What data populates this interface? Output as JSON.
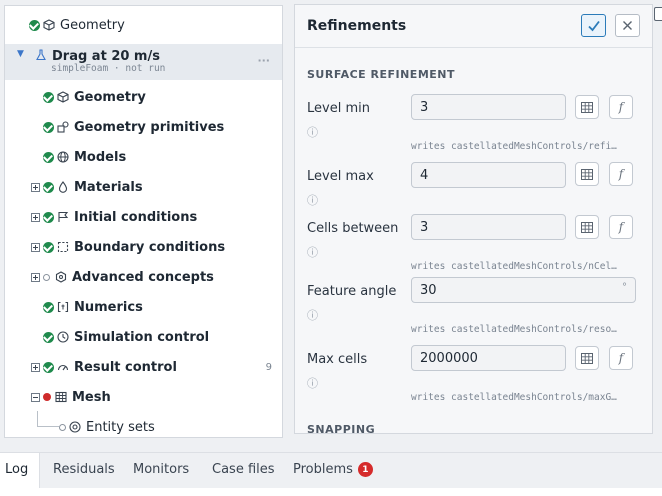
{
  "tree": {
    "items": [
      {
        "label": "Geometry"
      },
      {
        "label": "Drag at 20 m/s",
        "sub": "simpleFoam · not run",
        "more": "···"
      },
      {
        "label": "Geometry"
      },
      {
        "label": "Geometry primitives"
      },
      {
        "label": "Models"
      },
      {
        "label": "Materials"
      },
      {
        "label": "Initial conditions"
      },
      {
        "label": "Boundary conditions"
      },
      {
        "label": "Advanced concepts"
      },
      {
        "label": "Numerics"
      },
      {
        "label": "Simulation control"
      },
      {
        "label": "Result control",
        "count": "9"
      },
      {
        "label": "Mesh"
      },
      {
        "label": "Entity sets"
      }
    ]
  },
  "panel": {
    "title": "Refinements",
    "section_surface": "SURFACE REFINEMENT",
    "section_snapping": "SNAPPING",
    "info_glyph": "ⓘ",
    "fx_glyph": "f",
    "fields": [
      {
        "label": "Level min",
        "value": "3",
        "writes": "writes  castellatedMeshControls/refi…"
      },
      {
        "label": "Level max",
        "value": "4",
        "writes": ""
      },
      {
        "label": "Cells between",
        "value": "3",
        "writes": "writes  castellatedMeshControls/nCel…"
      },
      {
        "label": "Feature angle",
        "value": "30",
        "unit": "°",
        "writes": "writes  castellatedMeshControls/reso…"
      },
      {
        "label": "Max cells",
        "value": "2000000",
        "writes": "writes  castellatedMeshControls/maxG…"
      }
    ],
    "writes_top": "writes  castellatedMeshControls/refi…"
  },
  "tabs": [
    {
      "label": "Log"
    },
    {
      "label": "Residuals"
    },
    {
      "label": "Monitors"
    },
    {
      "label": "Case files"
    },
    {
      "label": "Problems",
      "badge": "1"
    }
  ],
  "log": {
    "line": "  ·  ·   ·  ·   ·   ·  ·"
  },
  "colors": {
    "ok": "#1f8a4c",
    "error": "#cf2b2b",
    "accent": "#2b7bb9"
  }
}
